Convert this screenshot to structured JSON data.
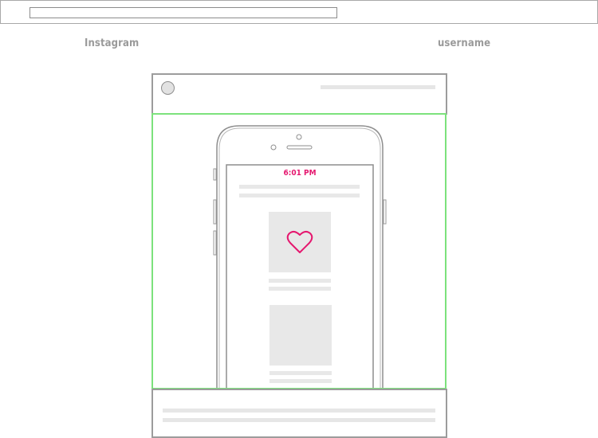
{
  "browser": {
    "url_value": ""
  },
  "labels": {
    "site": "Instagram",
    "user": "username"
  },
  "phone_screen": {
    "status_time": "6:01 PM"
  },
  "icons": {
    "avatar": "avatar-circle",
    "content": "heart-icon"
  },
  "colors": {
    "accent": "#e5186f",
    "highlight_border": "#7ce27c",
    "frame_border": "#9c9c9c",
    "placeholder_fill": "#e8e8e8",
    "label_text": "#9a9a9a"
  }
}
